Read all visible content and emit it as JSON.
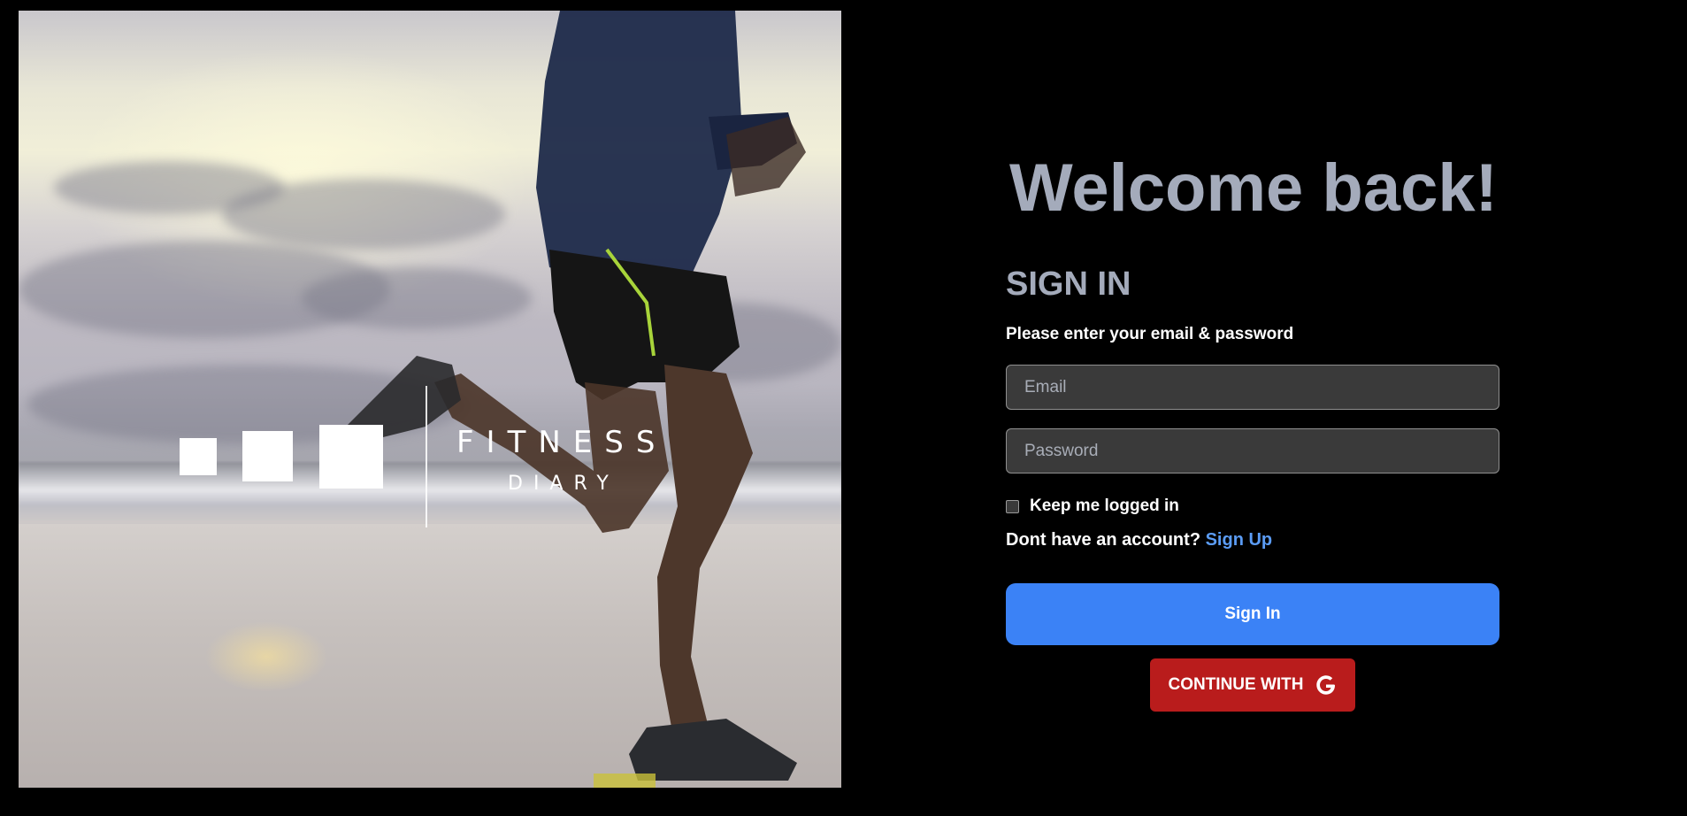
{
  "hero": {
    "image_description_icon": "runner-on-beach-photo",
    "logo": {
      "brand_top": "FITNESS",
      "brand_bottom": "DIARY"
    }
  },
  "form": {
    "welcome": "Welcome back!",
    "heading": "SIGN IN",
    "subtitle": "Please enter your email & password",
    "email_placeholder": "Email",
    "password_placeholder": "Password",
    "keep_logged_in": "Keep me logged in",
    "no_account_text": "Dont have an account?",
    "signup_link": "Sign Up",
    "signin_button": "Sign In",
    "google_button": "CONTINUE WITH",
    "google_icon": "google-g-icon"
  },
  "colors": {
    "background": "#000000",
    "heading": "#a4abbb",
    "primary_button": "#3b82f6",
    "google_button": "#b91c1c",
    "link": "#5b9cf5",
    "input_bg": "#3a3a3a"
  }
}
